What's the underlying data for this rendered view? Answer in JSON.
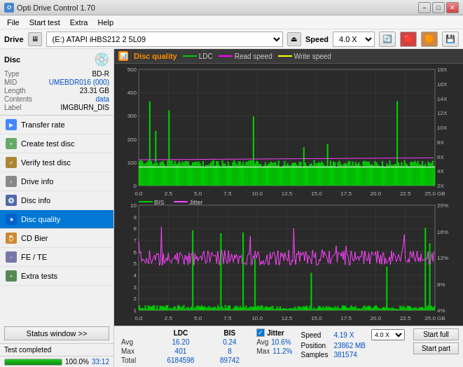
{
  "titlebar": {
    "title": "Opti Drive Control 1.70",
    "min": "−",
    "max": "□",
    "close": "✕"
  },
  "menubar": {
    "items": [
      "File",
      "Start test",
      "Extra",
      "Help"
    ]
  },
  "drivebar": {
    "label": "Drive",
    "drive_value": "(E:)  ATAPI iHBS212  2 5L09",
    "speed_label": "Speed",
    "speed_value": "4.0 X"
  },
  "disc": {
    "title": "Disc",
    "type_label": "Type",
    "type_value": "BD-R",
    "mid_label": "MID",
    "mid_value": "UMEBDR016 (000)",
    "length_label": "Length",
    "length_value": "23.31 GB",
    "contents_label": "Contents",
    "contents_value": "data",
    "label_label": "Label",
    "label_value": "IMGBURN_DIS"
  },
  "nav": {
    "items": [
      {
        "id": "transfer-rate",
        "label": "Transfer rate",
        "icon": "📊"
      },
      {
        "id": "create-test-disc",
        "label": "Create test disc",
        "icon": "💿"
      },
      {
        "id": "verify-test-disc",
        "label": "Verify test disc",
        "icon": "✓"
      },
      {
        "id": "drive-info",
        "label": "Drive info",
        "icon": "ℹ"
      },
      {
        "id": "disc-info",
        "label": "Disc info",
        "icon": "📀"
      },
      {
        "id": "disc-quality",
        "label": "Disc quality",
        "icon": "★",
        "active": true
      },
      {
        "id": "cd-bier",
        "label": "CD Bier",
        "icon": "🍺"
      },
      {
        "id": "fe-te",
        "label": "FE / TE",
        "icon": "~"
      },
      {
        "id": "extra-tests",
        "label": "Extra tests",
        "icon": "+"
      }
    ]
  },
  "status_window_btn": "Status window >>",
  "status_bar": {
    "text": "Test completed",
    "progress": 100,
    "progress_text": "100.0%",
    "time": "33:12"
  },
  "chart1": {
    "title": "Disc quality",
    "legends": [
      {
        "id": "ldc",
        "label": "LDC",
        "color": "#00cc00"
      },
      {
        "id": "read-speed",
        "label": "Read speed",
        "color": "#ff00ff"
      },
      {
        "id": "write-speed",
        "label": "Write speed",
        "color": "#ffff00"
      }
    ],
    "y_max": 500,
    "y_labels": [
      "500",
      "400",
      "300",
      "200",
      "100",
      "0"
    ],
    "y_right_labels": [
      "18X",
      "16X",
      "14X",
      "12X",
      "10X",
      "8X",
      "6X",
      "4X",
      "2X"
    ],
    "x_labels": [
      "0.0",
      "2.5",
      "5.0",
      "7.5",
      "10.0",
      "12.5",
      "15.0",
      "17.5",
      "20.0",
      "22.5",
      "25.0 GB"
    ]
  },
  "chart2": {
    "legends": [
      {
        "id": "bis",
        "label": "BIS",
        "color": "#00cc00"
      },
      {
        "id": "jitter",
        "label": "Jitter",
        "color": "#ff44ff"
      }
    ],
    "y_max": 10,
    "y_labels": [
      "10",
      "9",
      "8",
      "7",
      "6",
      "5",
      "4",
      "3",
      "2",
      "1"
    ],
    "y_right_labels": [
      "20%",
      "16%",
      "12%",
      "8%",
      "4%"
    ],
    "x_labels": [
      "0.0",
      "2.5",
      "5.0",
      "7.5",
      "10.0",
      "12.5",
      "15.0",
      "17.5",
      "20.0",
      "22.5",
      "25.0 GB"
    ]
  },
  "stats": {
    "col_headers": [
      "",
      "LDC",
      "BIS"
    ],
    "rows": [
      {
        "label": "Avg",
        "ldc": "16.20",
        "bis": "0.24"
      },
      {
        "label": "Max",
        "ldc": "401",
        "bis": "8"
      },
      {
        "label": "Total",
        "ldc": "6184598",
        "bis": "89742"
      }
    ],
    "jitter": {
      "label": "Jitter",
      "checked": true,
      "avg": "10.6%",
      "max": "11.2%"
    },
    "speed": {
      "speed_label": "Speed",
      "speed_value": "4.19 X",
      "speed_select": "4.0 X",
      "position_label": "Position",
      "position_value": "23862 MB",
      "samples_label": "Samples",
      "samples_value": "381574"
    },
    "buttons": {
      "start_full": "Start full",
      "start_part": "Start part"
    }
  }
}
